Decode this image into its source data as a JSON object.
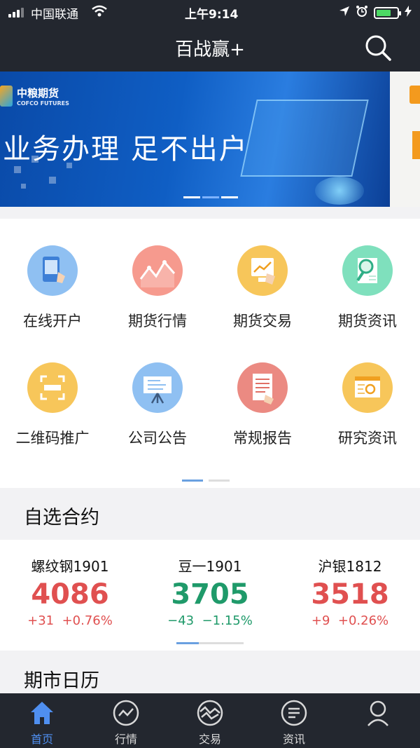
{
  "status_bar": {
    "carrier": "中国联通",
    "time": "上午9:14"
  },
  "header": {
    "title": "百战赢+"
  },
  "banner": {
    "brand": "中粮期货",
    "brand_en": "COFCO FUTURES",
    "headline": "业务办理 足不出户",
    "slide_count": 3,
    "active_slide": 2
  },
  "menu": {
    "items": [
      {
        "label": "在线开户",
        "icon": "account-open-icon",
        "color": "#6fa8e8"
      },
      {
        "label": "期货行情",
        "icon": "market-chart-icon",
        "color": "#f0796e"
      },
      {
        "label": "期货交易",
        "icon": "trade-icon",
        "color": "#f6b93b"
      },
      {
        "label": "期货资讯",
        "icon": "news-search-icon",
        "color": "#4fd0a5"
      },
      {
        "label": "二维码推广",
        "icon": "qr-scan-icon",
        "color": "#f6b93b"
      },
      {
        "label": "公司公告",
        "icon": "announcement-board-icon",
        "color": "#6fa8e8"
      },
      {
        "label": "常规报告",
        "icon": "report-icon",
        "color": "#e07066"
      },
      {
        "label": "研究资讯",
        "icon": "research-icon",
        "color": "#f6b93b"
      }
    ],
    "pages": 2,
    "active_page": 1
  },
  "watchlist": {
    "title": "自选合约",
    "quotes": [
      {
        "name": "螺纹钢1901",
        "price": "4086",
        "change": "+31",
        "pct": "+0.76%",
        "direction": "up"
      },
      {
        "name": "豆一1901",
        "price": "3705",
        "change": "−43",
        "pct": "−1.15%",
        "direction": "down"
      },
      {
        "name": "沪银1812",
        "price": "3518",
        "change": "+9",
        "pct": "+0.26%",
        "direction": "up"
      }
    ]
  },
  "calendar": {
    "title": "期市日历"
  },
  "tabbar": {
    "tabs": [
      {
        "label": "首页",
        "icon": "home-icon",
        "active": true
      },
      {
        "label": "行情",
        "icon": "market-icon",
        "active": false
      },
      {
        "label": "交易",
        "icon": "trade-tab-icon",
        "active": false
      },
      {
        "label": "资讯",
        "icon": "news-icon",
        "active": false
      },
      {
        "label": "",
        "icon": "profile-icon",
        "active": false
      }
    ]
  },
  "colors": {
    "header_bg": "#23272f",
    "accent": "#4f8ff0",
    "up": "#e05050",
    "down": "#1f9a6a"
  }
}
